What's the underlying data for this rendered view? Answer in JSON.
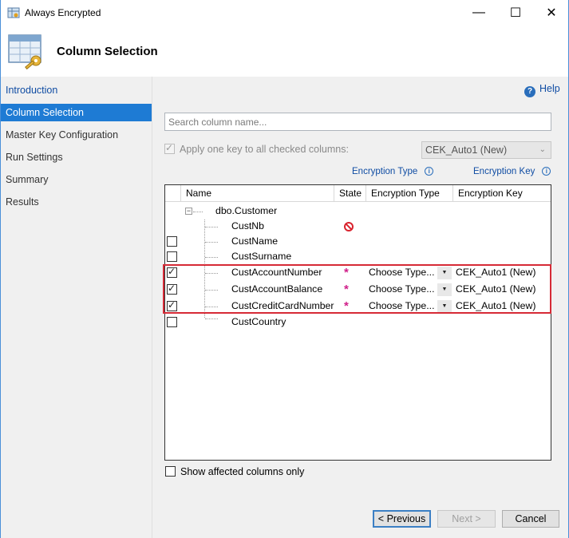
{
  "window": {
    "title": "Always Encrypted",
    "minimize_label": "—",
    "maximize_label": "☐",
    "close_label": "✕"
  },
  "header": {
    "title": "Column Selection"
  },
  "nav": {
    "items": [
      {
        "label": "Introduction",
        "state": "link"
      },
      {
        "label": "Column Selection",
        "state": "active"
      },
      {
        "label": "Master Key Configuration",
        "state": "normal"
      },
      {
        "label": "Run Settings",
        "state": "normal"
      },
      {
        "label": "Summary",
        "state": "normal"
      },
      {
        "label": "Results",
        "state": "normal"
      }
    ]
  },
  "help": {
    "label": "Help"
  },
  "search": {
    "placeholder": "Search column name..."
  },
  "apply_key": {
    "label": "Apply one key to all checked columns:",
    "checked": true,
    "disabled": true,
    "selected_key": "CEK_Auto1 (New)"
  },
  "hints": {
    "encryption_type": "Encryption Type",
    "encryption_key": "Encryption Key",
    "info_icon": "i"
  },
  "grid": {
    "columns": {
      "name": "Name",
      "state": "State",
      "encryption_type": "Encryption Type",
      "encryption_key": "Encryption Key"
    },
    "table": {
      "name": "dbo.Customer",
      "expander": "−"
    },
    "rows": [
      {
        "name": "CustNb",
        "checkbox": false,
        "checked": false,
        "state": "blocked",
        "encryption_type": "",
        "encryption_key": ""
      },
      {
        "name": "CustName",
        "checkbox": true,
        "checked": false,
        "state": "",
        "encryption_type": "",
        "encryption_key": ""
      },
      {
        "name": "CustSurname",
        "checkbox": true,
        "checked": false,
        "state": "",
        "encryption_type": "",
        "encryption_key": ""
      },
      {
        "name": "CustAccountNumber",
        "checkbox": true,
        "checked": true,
        "state": "*",
        "encryption_type": "Choose Type...",
        "encryption_key": "CEK_Auto1 (New)"
      },
      {
        "name": "CustAccountBalance",
        "checkbox": true,
        "checked": true,
        "state": "*",
        "encryption_type": "Choose Type...",
        "encryption_key": "CEK_Auto1 (New)"
      },
      {
        "name": "CustCreditCardNumber",
        "checkbox": true,
        "checked": true,
        "state": "*",
        "encryption_type": "Choose Type...",
        "encryption_key": "CEK_Auto1 (New)"
      },
      {
        "name": "CustCountry",
        "checkbox": true,
        "checked": false,
        "state": "",
        "encryption_type": "",
        "encryption_key": ""
      }
    ]
  },
  "show_affected": {
    "label": "Show affected columns only",
    "checked": false
  },
  "buttons": {
    "previous": "< Previous",
    "next": "Next >",
    "cancel": "Cancel"
  },
  "colors": {
    "accent": "#1e7bd4",
    "link": "#0f4ca3",
    "highlight_border": "#d62a36",
    "state_star": "#d0208a"
  }
}
